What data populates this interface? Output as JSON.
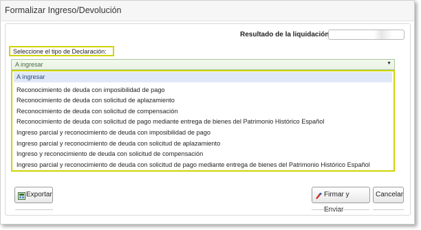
{
  "window": {
    "title": "Formalizar Ingreso/Devolución"
  },
  "result": {
    "label": "Resultado de la liquidación",
    "value": ""
  },
  "declaration": {
    "label": "Seleccione el tipo de Declaración:",
    "selected": "A ingresar",
    "options": [
      "A ingresar",
      "Reconocimiento de deuda con imposibilidad de pago",
      "Reconocimiento de deuda con solicitud de aplazamiento",
      "Reconocimiento de deuda con solicitud de compensación",
      "Reconocimiento de deuda con solicitud de pago mediante entrega de bienes del Patrimonio Histórico Español",
      "Ingreso parcial y reconocimiento de deuda con imposibilidad de pago",
      "Ingreso parcial y reconocimiento de deuda con solicitud de aplazamiento",
      "Ingreso y reconocimiento de deuda con solicitud de compensación",
      "Ingreso parcial y reconocimiento de deuda con solicitud de pago mediante entrega de bienes del Patrimonio Histórico Español"
    ]
  },
  "buttons": {
    "export": "Exportar",
    "sign": "Firmar y Enviar",
    "cancel": "Cancelar"
  },
  "colors": {
    "highlight": "#cfd400",
    "selected_bg": "#dfe8f6"
  }
}
